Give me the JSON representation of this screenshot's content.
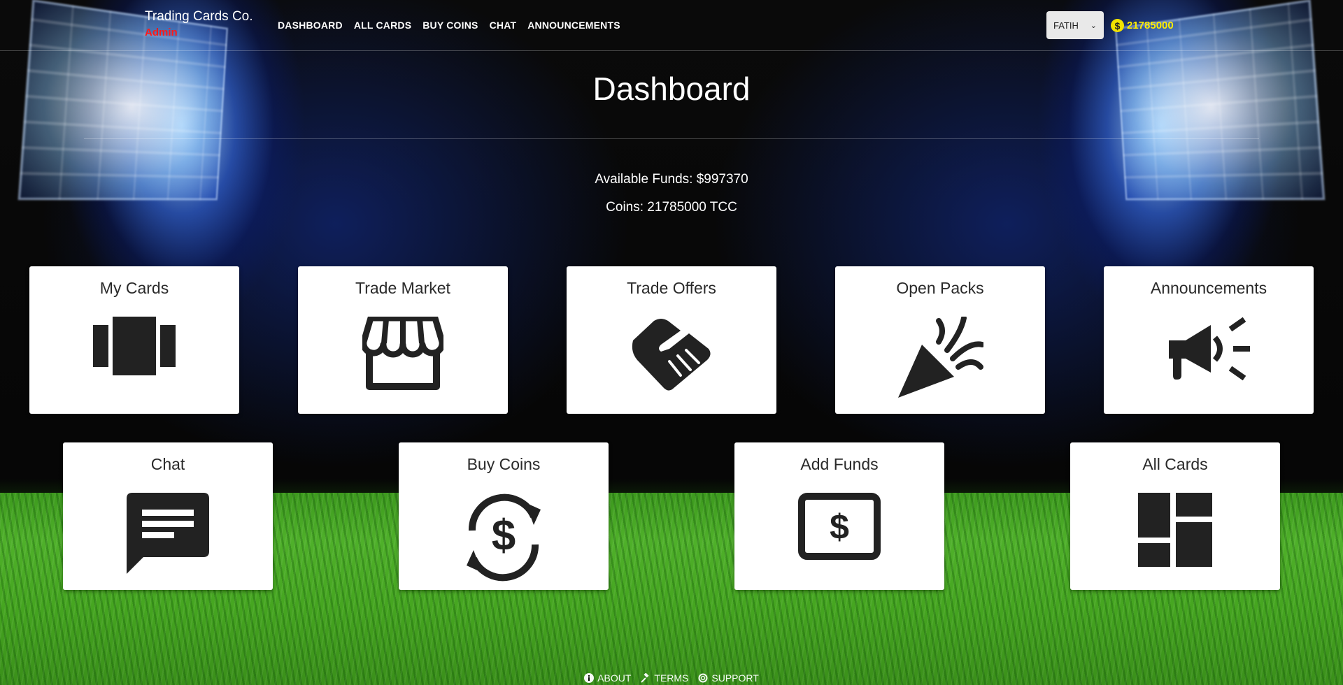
{
  "brand": {
    "title": "Trading Cards Co.",
    "role": "Admin"
  },
  "nav": [
    "DASHBOARD",
    "ALL CARDS",
    "BUY COINS",
    "CHAT",
    "ANNOUNCEMENTS"
  ],
  "user": {
    "name": "FATIH",
    "coins": "21785000"
  },
  "page": {
    "title": "Dashboard",
    "funds": "Available Funds: $997370",
    "coins": "Coins: 21785000 TCC"
  },
  "cards": [
    {
      "label": "My Cards",
      "icon": "cards-carousel-icon"
    },
    {
      "label": "Trade Market",
      "icon": "storefront-icon"
    },
    {
      "label": "Trade Offers",
      "icon": "handshake-icon"
    },
    {
      "label": "Open Packs",
      "icon": "party-popper-icon"
    },
    {
      "label": "Announcements",
      "icon": "megaphone-icon"
    },
    {
      "label": "Chat",
      "icon": "chat-bubble-icon"
    },
    {
      "label": "Buy Coins",
      "icon": "currency-exchange-icon"
    },
    {
      "label": "Add Funds",
      "icon": "money-bill-icon"
    },
    {
      "label": "All Cards",
      "icon": "dashboard-grid-icon"
    }
  ],
  "footer": [
    "ABOUT",
    "TERMS",
    "SUPPORT"
  ],
  "colors": {
    "role": "#ff1a1a",
    "coins": "#ffee00",
    "card_bg": "#ffffff"
  }
}
